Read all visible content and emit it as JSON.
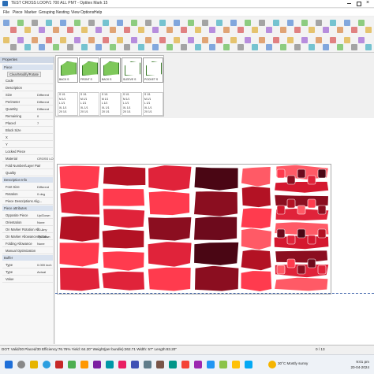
{
  "window": {
    "title": "TEST CROSS LOOP/1 700 ALL PMT - Optitex Mark 15"
  },
  "menu": [
    "File",
    "Piece",
    "Marker",
    "Grouping",
    "Nesting",
    "View",
    "Options",
    "Help"
  ],
  "properties": {
    "title": "Properties",
    "section_piece": "Piece",
    "clear_button": "Clear/Modify/Rotate",
    "rows": [
      {
        "label": "Code",
        "value": ""
      },
      {
        "label": "Description",
        "value": ""
      },
      {
        "label": "Size",
        "value": "Different"
      },
      {
        "label": "Perimeter",
        "value": "Different"
      },
      {
        "label": "Quantity",
        "value": "Different"
      },
      {
        "label": "Remaining",
        "value": "0"
      },
      {
        "label": "Placed",
        "value": "7"
      },
      {
        "label": "Block Size",
        "value": ""
      },
      {
        "label": "X",
        "value": ""
      },
      {
        "label": "Y",
        "value": ""
      },
      {
        "label": "Locked Piece",
        "value": ""
      },
      {
        "label": "Material",
        "value": "CROSS LO"
      },
      {
        "label": "Fold Number/Layer Pair",
        "value": ""
      },
      {
        "label": "Quality",
        "value": ""
      }
    ],
    "section_description": "Description Info",
    "rows2": [
      {
        "label": "Font Size",
        "value": "Different"
      },
      {
        "label": "Rotation",
        "value": "0 deg"
      },
      {
        "label": "Piece Descriptions Alig...",
        "value": ""
      }
    ],
    "section_attributes": "Piece attributes",
    "rows3": [
      {
        "label": "Opposite Piece",
        "value": "Up/Down"
      },
      {
        "label": "Orientation",
        "value": "None"
      },
      {
        "label": "On Marker Rotation Allo...",
        "value": "2 - Any"
      },
      {
        "label": "On Marker Allowance Rotati...",
        "value": "Up/Down"
      },
      {
        "label": "Folding Allowance",
        "value": "None"
      },
      {
        "label": "Manual Optimization",
        "value": ""
      }
    ],
    "section_buffer": "Buffer",
    "rows4": [
      {
        "label": "Type",
        "value": "0.059 inch"
      },
      {
        "label": "Type",
        "value": "Actual"
      },
      {
        "label": "Value",
        "value": ""
      }
    ]
  },
  "pieceset": {
    "thumbs": [
      {
        "label": "BACK S",
        "color": "#7ec85a"
      },
      {
        "label": "FRONT S",
        "color": "#7ec85a"
      },
      {
        "label": "BACK S",
        "color": "#7ec85a"
      },
      {
        "label": "SLEEVE S",
        "color": "#ffffff"
      },
      {
        "label": "POCKET S",
        "color": "#ffffff"
      }
    ],
    "qty": [
      [
        "S 1/1",
        "M 1/1",
        "L 1/1",
        "XL 1/1",
        "2X 1/1"
      ],
      [
        "S 1/1",
        "M 1/1",
        "L 1/1",
        "XL 1/1",
        "2X 1/1"
      ],
      [
        "S 1/1",
        "M 1/1",
        "L 1/1",
        "XL 1/1",
        "2X 1/1"
      ],
      [
        "S 1/1",
        "M 1/1",
        "L 1/1",
        "XL 1/1",
        "2X 1/1"
      ],
      [
        "S 1/1",
        "M 1/1",
        "L 1/1",
        "XL 1/1",
        "2X 1/1"
      ]
    ]
  },
  "status": {
    "left": "DOT: Valid/30  Placed/30  Efficiency:76.76%  Yield: 64.20\"  Weight(per bundle):262.71  Width: 57\"  Length:83.20\"",
    "right": "0 / 13"
  },
  "taskbar": {
    "weather": "30°C  Mostly sunny",
    "time": "9:01 pm",
    "date": "20-04-2024"
  },
  "colors": {
    "accent": "#c8102e",
    "piece_light": "#ff3b4e",
    "piece_mid": "#b31224",
    "piece_dark": "#4a0614"
  }
}
